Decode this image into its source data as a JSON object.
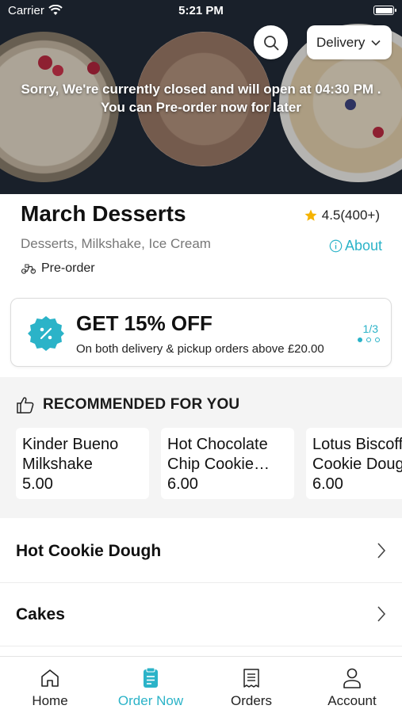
{
  "status_bar": {
    "carrier": "Carrier",
    "time": "5:21 PM"
  },
  "header": {
    "delivery_mode": "Delivery",
    "closed_message_line1": "Sorry, We're currently closed and will open at 04:30 PM .",
    "closed_message_line2": "You can Pre-order now for later"
  },
  "restaurant": {
    "name": "March Desserts",
    "rating": "4.5(400+)",
    "cuisines": "Desserts, Milkshake, Ice Cream",
    "about_label": "About",
    "order_type": "Pre-order"
  },
  "promo": {
    "title": "GET 15% OFF",
    "subtitle": "On both delivery & pickup orders above £20.00",
    "pager": "1/3",
    "total": 3,
    "current": 1
  },
  "recommended": {
    "heading": "RECOMMENDED FOR YOU",
    "items": [
      {
        "name": "Kinder Bueno Milkshake",
        "price": "5.00"
      },
      {
        "name": "Hot Chocolate Chip Cookie…",
        "price": "6.00"
      },
      {
        "name": "Lotus Biscoff Cookie Dough",
        "price": "6.00"
      }
    ]
  },
  "categories": [
    {
      "label": "Hot Cookie Dough"
    },
    {
      "label": "Cakes"
    }
  ],
  "tabs": [
    {
      "label": "Home",
      "icon": "home-icon"
    },
    {
      "label": "Order Now",
      "icon": "order-icon"
    },
    {
      "label": "Orders",
      "icon": "receipt-icon"
    },
    {
      "label": "Account",
      "icon": "person-icon"
    }
  ],
  "colors": {
    "accent": "#2bb3c8",
    "star": "#f5b301"
  }
}
